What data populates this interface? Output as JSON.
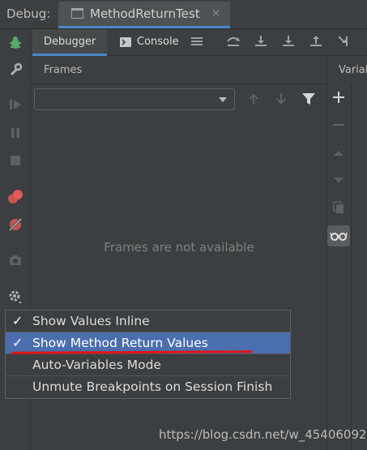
{
  "title_bar": {
    "debug_label": "Debug:",
    "run_config": "MethodReturnTest",
    "close_glyph": "×"
  },
  "tabs": {
    "debugger": "Debugger",
    "console": "Console"
  },
  "frames": {
    "header": "Frames",
    "empty_message": "Frames are not available"
  },
  "variables": {
    "header_partial": "Variab"
  },
  "settings_menu": {
    "items": [
      {
        "label": "Show Values Inline",
        "checked": true,
        "selected": false
      },
      {
        "label": "Show Method Return Values",
        "checked": true,
        "selected": true
      },
      {
        "label": "Auto-Variables Mode",
        "checked": false,
        "selected": false
      },
      {
        "label": "Unmute Breakpoints on Session Finish",
        "checked": false,
        "selected": false
      }
    ],
    "check_glyph": "✓"
  },
  "watermark": "https://blog.csdn.net/w_45406092",
  "colors": {
    "background": "#3c3f41",
    "accent_blue": "#4a88c7",
    "selection": "#4b6eaf",
    "annotation_red": "#e01515"
  },
  "icons": [
    "bug-icon",
    "wrench-icon",
    "resume-icon",
    "pause-icon",
    "stop-icon",
    "breakpoints-icon",
    "mute-breakpoints-icon",
    "camera-icon",
    "settings-gear-icon",
    "layout-icon",
    "step-over-icon",
    "step-into-icon",
    "force-step-into-icon",
    "step-out-icon",
    "run-to-cursor-icon",
    "filter-icon",
    "add-watch-icon",
    "remove-watch-icon",
    "up-icon",
    "down-icon",
    "copy-icon",
    "glasses-icon"
  ]
}
